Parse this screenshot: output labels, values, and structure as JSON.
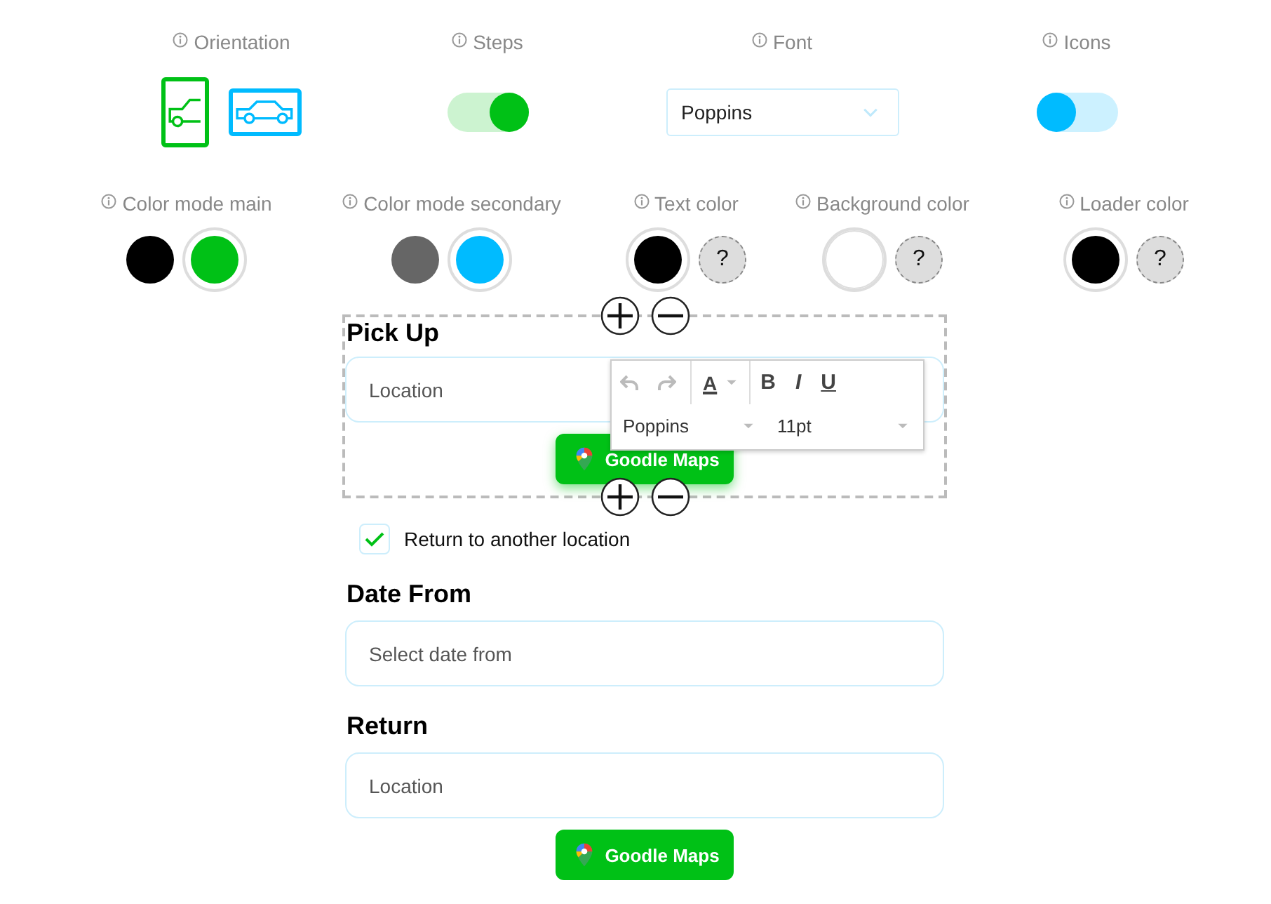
{
  "settings_row": [
    {
      "label": "Orientation",
      "kind": "orientation",
      "options": [
        {
          "kind": "portrait",
          "selected": true
        },
        {
          "kind": "landscape",
          "selected": false
        }
      ]
    },
    {
      "label": "Steps",
      "kind": "toggle",
      "on": true,
      "color": "#00c116"
    },
    {
      "label": "Font",
      "kind": "select",
      "value": "Poppins"
    },
    {
      "label": "Icons",
      "kind": "toggle",
      "on": false,
      "color": "#00bbff"
    }
  ],
  "color_row": [
    {
      "label": "Color mode main",
      "swatches": [
        {
          "kind": "color",
          "color": "#000000",
          "selected": false
        },
        {
          "kind": "color",
          "color": "#00c116",
          "selected": true
        }
      ]
    },
    {
      "label": "Color mode secondary",
      "swatches": [
        {
          "kind": "color",
          "color": "#666666",
          "selected": false
        },
        {
          "kind": "color",
          "color": "#00bbff",
          "selected": true
        }
      ]
    },
    {
      "label": "Text color",
      "swatches": [
        {
          "kind": "color",
          "color": "#000000",
          "selected": true
        },
        {
          "kind": "unset",
          "label": "?"
        }
      ]
    },
    {
      "label": "Background color",
      "swatches": [
        {
          "kind": "color",
          "color": "#ffffff",
          "selected": true
        },
        {
          "kind": "unset",
          "label": "?"
        }
      ]
    },
    {
      "label": "Loader color",
      "swatches": [
        {
          "kind": "color",
          "color": "#000000",
          "selected": true
        },
        {
          "kind": "unset",
          "label": "?"
        }
      ]
    }
  ],
  "pick_up": {
    "title": "Pick Up",
    "placeholder": "Location",
    "button": "Goodle Maps"
  },
  "editor_toolbar": {
    "text_color": "A",
    "format_buttons": [
      "B",
      "I",
      "U"
    ],
    "font": "Poppins",
    "size": "11pt"
  },
  "return_checkbox": {
    "label": "Return to another location",
    "checked": true
  },
  "date_from": {
    "title": "Date From",
    "placeholder": "Select date from"
  },
  "return": {
    "title": "Return",
    "placeholder": "Location",
    "button": "Goodle Maps"
  }
}
